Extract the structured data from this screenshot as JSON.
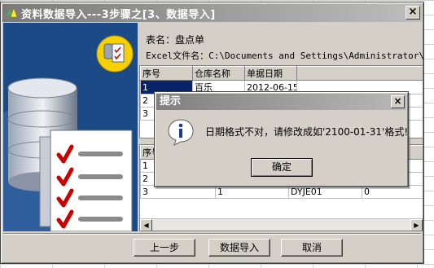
{
  "window": {
    "title": "资料数据导入---3步骤之[3、数据导入]",
    "close_label": "×"
  },
  "form": {
    "table_name": "表名：盘点单",
    "excel_file": "Excel文件名：C:\\Documents and Settings\\Administrator\\桌面"
  },
  "top_grid": {
    "headers": [
      "序号",
      "仓库名称",
      "单据日期"
    ],
    "rows": [
      [
        "1",
        "百乐",
        "2012-06-15"
      ],
      [
        "2",
        "",
        ""
      ],
      [
        "3",
        "",
        ""
      ]
    ]
  },
  "bottom_grid": {
    "header": "序号",
    "rows": [
      [
        "1",
        "",
        "",
        ""
      ],
      [
        "2",
        "",
        "",
        ""
      ],
      [
        "3",
        "1",
        "DYJE01",
        "0"
      ]
    ]
  },
  "buttons": {
    "prev": "上一步",
    "import": "数据导入",
    "cancel": "取消"
  },
  "dialog": {
    "title": "提示",
    "close_label": "×",
    "message": "日期格式不对，请修改成如'2100-01-31'格式!",
    "ok": "确定",
    "icon": "info-icon"
  }
}
